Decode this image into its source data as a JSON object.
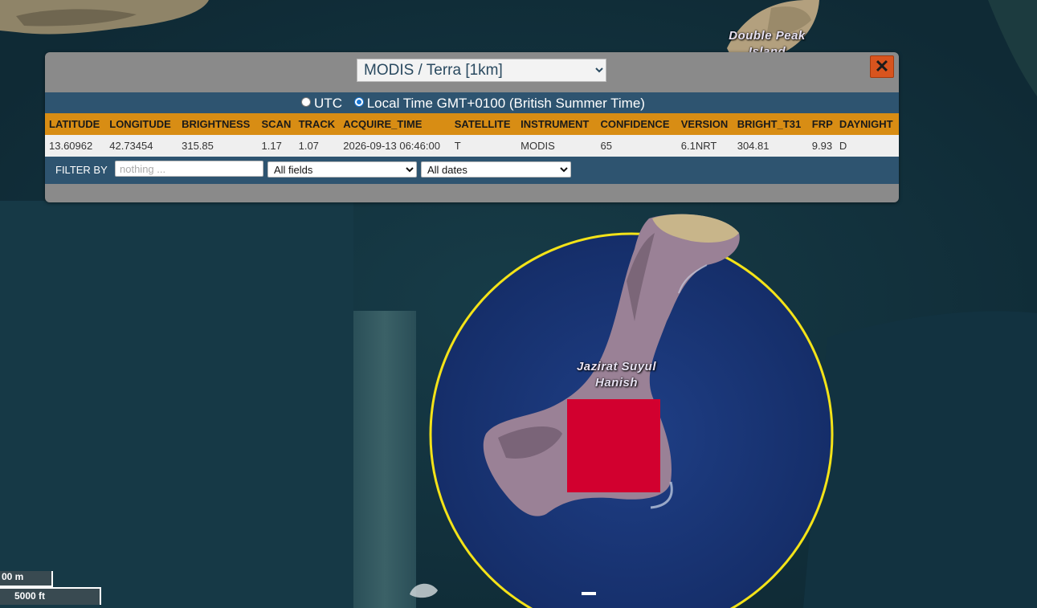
{
  "map": {
    "labels": {
      "double_peak": "Double Peak Island",
      "jazirat": "Jazirat Suyul Hanish"
    },
    "scale": {
      "metric": "00 m",
      "imperial": "5000 ft"
    },
    "colors": {
      "water": "#14323f",
      "selection_circle": "#f4e318",
      "fire_marker": "#d2002f"
    }
  },
  "popup": {
    "sensor_options": [
      "MODIS / Terra [1km]"
    ],
    "sensor_selected": "MODIS / Terra [1km]",
    "close_icon": "✕",
    "time": {
      "utc_label": "UTC",
      "local_label": "Local Time GMT+0100 (British Summer Time)",
      "selected": "local"
    },
    "table": {
      "headers": [
        "LATITUDE",
        "LONGITUDE",
        "BRIGHTNESS",
        "SCAN",
        "TRACK",
        "ACQUIRE_TIME",
        "SATELLITE",
        "INSTRUMENT",
        "CONFIDENCE",
        "VERSION",
        "BRIGHT_T31",
        "FRP",
        "DAYNIGHT"
      ],
      "rows": [
        [
          "13.60962",
          "42.73454",
          "315.85",
          "1.17",
          "1.07",
          "2026-09-13 06:46:00",
          "T",
          "MODIS",
          "65",
          "6.1NRT",
          "304.81",
          "9.93",
          "D"
        ]
      ]
    },
    "filter": {
      "label": "FILTER BY",
      "placeholder": "nothing ...",
      "field_options": [
        "All fields"
      ],
      "field_selected": "All fields",
      "date_options": [
        "All dates"
      ],
      "date_selected": "All dates"
    },
    "colors": {
      "panel": "#8a8a8a",
      "bar": "#2e5470",
      "header": "#d88d14",
      "close_button": "#d8541e"
    }
  }
}
